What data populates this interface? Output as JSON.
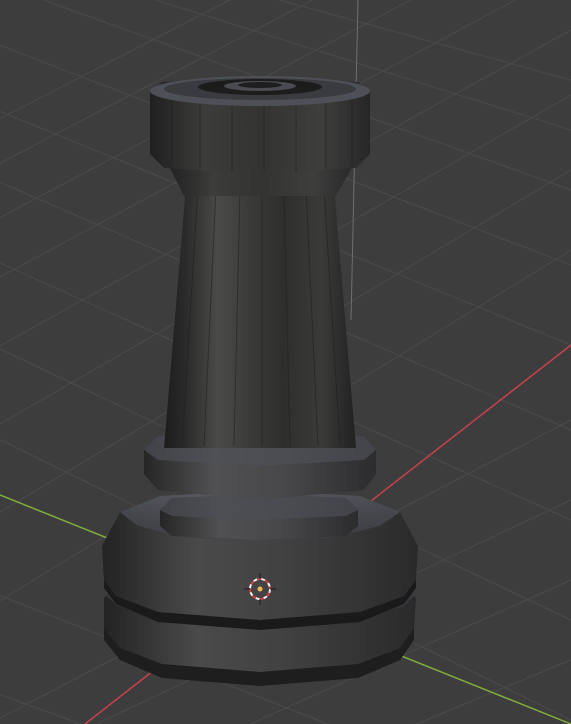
{
  "viewport": {
    "mode": "solid-shading",
    "background_color": "#3d3d3d",
    "grid_color": "#4a4a4a",
    "x_axis_color": "#c8414c",
    "y_axis_color": "#7fae3b",
    "z_axis_color": "#6e6e6e"
  },
  "object": {
    "type": "chess-rook",
    "material_color": "#3b3b3b"
  },
  "cursor": {
    "icon": "3d-cursor-icon",
    "ring_color_a": "#d63a3a",
    "ring_color_b": "#f2f2f2",
    "center_color": "#f0b84a"
  }
}
